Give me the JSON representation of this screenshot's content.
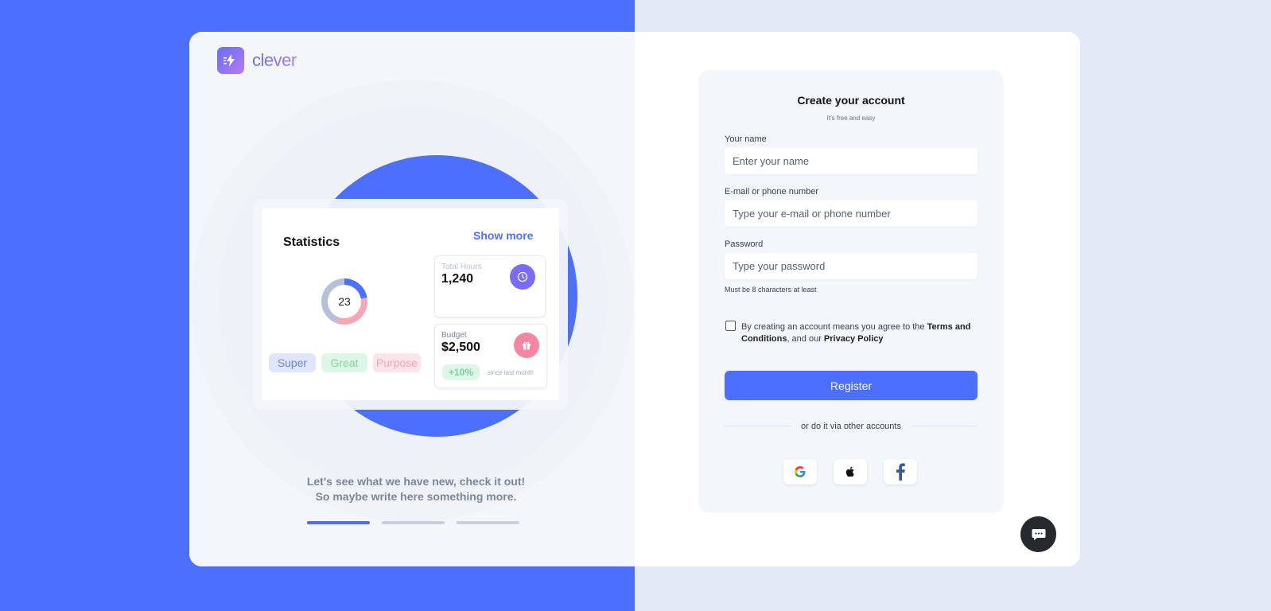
{
  "brand": {
    "name": "clever",
    "logo_icon": "bolt-icon",
    "accent_color": "#4d6ffd"
  },
  "statistics": {
    "title": "Statistics",
    "show_more": "Show more",
    "donut_value": "23",
    "chips": [
      "Super",
      "Great",
      "Purpose"
    ],
    "total_hours": {
      "label": "Total Hours",
      "value": "1,240",
      "icon": "clock-icon"
    },
    "budget": {
      "label": "Budget",
      "value": "$2,500",
      "growth": "+10%",
      "since": "since last month",
      "icon": "gift-icon"
    }
  },
  "tagline": "Let's see what we have new, check it out! So maybe write here something more.",
  "carousel": {
    "active_index": 0,
    "count": 3
  },
  "form": {
    "title": "Create your account",
    "subtitle": "It's free and easy",
    "name_label": "Your name",
    "name_placeholder": "Enter your name",
    "email_label": "E-mail or phone number",
    "email_placeholder": "Type your e-mail or phone number",
    "password_label": "Password",
    "password_placeholder": "Type your password",
    "password_hint": "Must be 8 characters at least",
    "terms_prefix": "By creating an account means you agree to the ",
    "terms_link": "Terms and Conditions",
    "terms_middle": ", and our ",
    "privacy_link": "Privacy Policy",
    "register_label": "Register",
    "divider_text": "or do it via other accounts",
    "social": [
      "google-icon",
      "apple-icon",
      "facebook-icon"
    ]
  },
  "chat": {
    "icon": "chat-icon"
  }
}
